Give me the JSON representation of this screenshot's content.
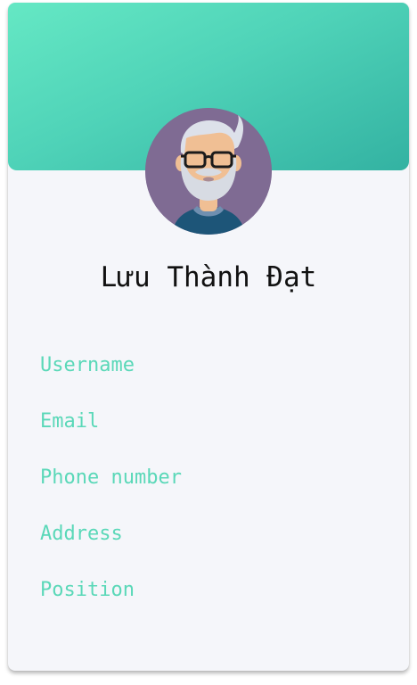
{
  "profile": {
    "name": "Lưu Thành Đạt",
    "avatar_icon": "bearded-man-with-glasses-avatar"
  },
  "fields": [
    {
      "label": "Username"
    },
    {
      "label": "Email"
    },
    {
      "label": "Phone number"
    },
    {
      "label": "Address"
    },
    {
      "label": "Position"
    }
  ],
  "colors": {
    "header_gradient_start": "#65e8c4",
    "header_gradient_end": "#33b2a2",
    "card_background": "#f5f6fa",
    "label_color": "#5ad8b8",
    "name_color": "#111111",
    "avatar_background": "#7f6b93"
  }
}
